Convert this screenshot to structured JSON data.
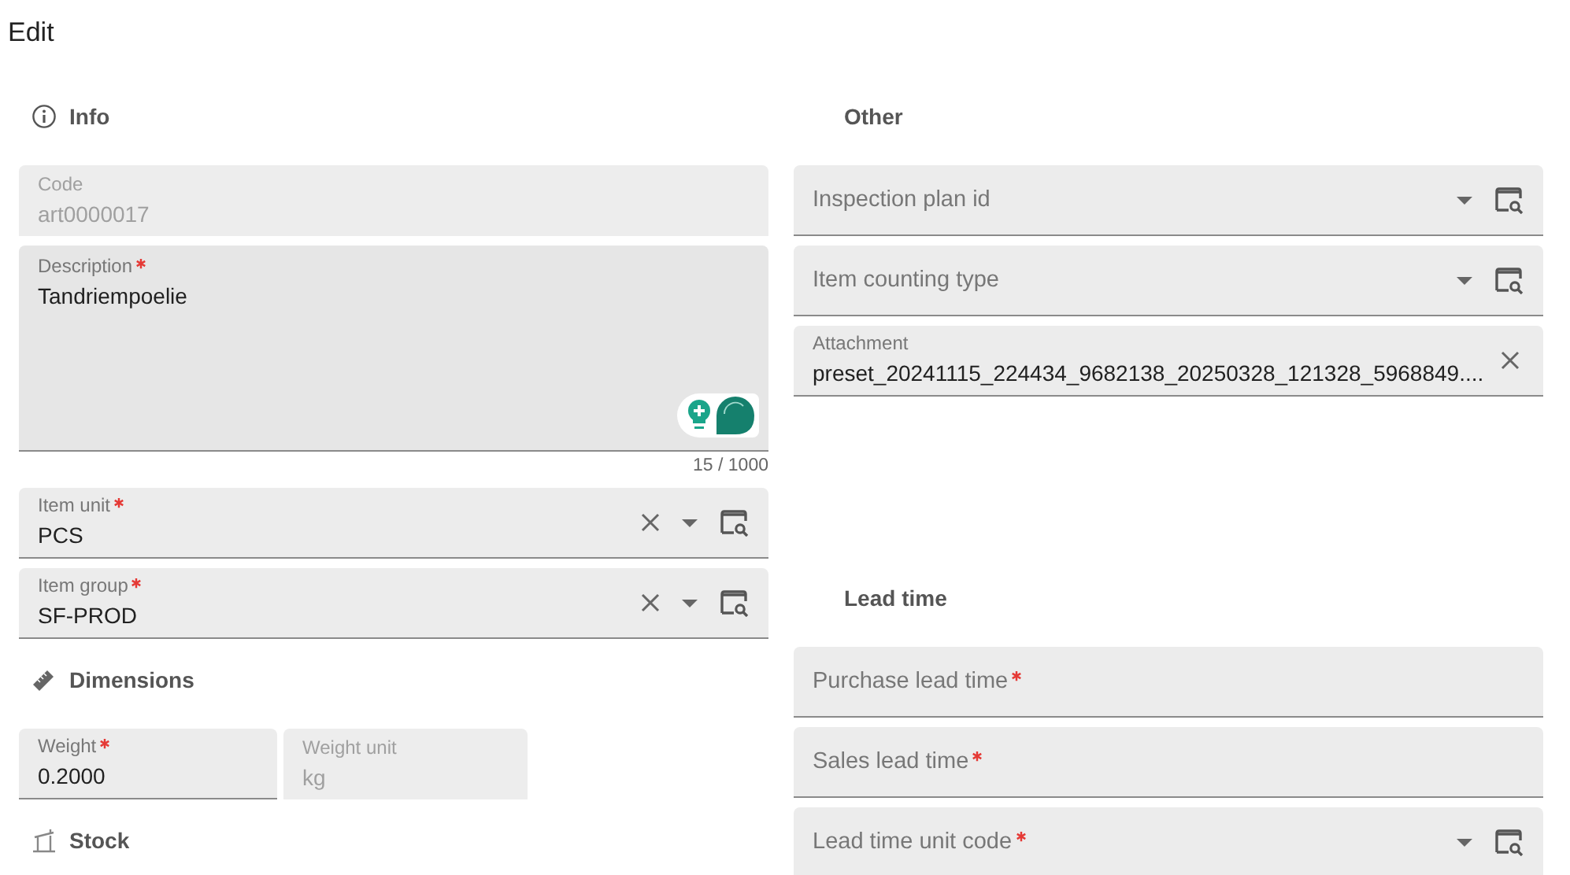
{
  "title": "Edit",
  "columns": [
    {
      "sections": [
        {
          "kind": "info",
          "title": "Info",
          "fields": [
            {
              "kind": "text",
              "label": "Code",
              "value": "art0000017",
              "required": false,
              "disabled": true
            },
            {
              "kind": "textarea",
              "label": "Description",
              "value": "Tandriempoelie",
              "required": true,
              "disabled": false,
              "counter": "15 / 1000"
            },
            {
              "kind": "select",
              "label": "Item unit",
              "value": "PCS",
              "required": true,
              "disabled": false,
              "clearable": true
            },
            {
              "kind": "select",
              "label": "Item group",
              "value": "SF-PROD",
              "required": true,
              "disabled": false,
              "clearable": true
            }
          ]
        },
        {
          "kind": "dimensions",
          "title": "Dimensions",
          "fields": [
            {
              "kind": "row",
              "fields": [
                {
                  "kind": "text",
                  "label": "Weight",
                  "value": "0.2000",
                  "required": true,
                  "disabled": false
                },
                {
                  "kind": "text",
                  "label": "Weight unit",
                  "value": "kg",
                  "required": false,
                  "disabled": true
                }
              ]
            }
          ]
        },
        {
          "kind": "stock",
          "title": "Stock"
        }
      ]
    },
    {
      "sections": [
        {
          "kind": "plain",
          "title": "Other",
          "fields": [
            {
              "kind": "select",
              "label": "Inspection plan id",
              "required": false,
              "disabled": false,
              "clearable": false
            },
            {
              "kind": "select",
              "label": "Item counting type",
              "required": false,
              "disabled": false,
              "clearable": false
            },
            {
              "kind": "file",
              "label": "Attachment",
              "value": "preset_20241115_224434_9682138_20250328_121328_5968849....",
              "required": false,
              "disabled": false,
              "clearable": true
            }
          ]
        },
        {
          "kind": "plain",
          "title": "Lead time",
          "fields": [
            {
              "kind": "text",
              "label": "Purchase lead time",
              "required": true,
              "disabled": false
            },
            {
              "kind": "text",
              "label": "Sales lead time",
              "required": true,
              "disabled": false
            },
            {
              "kind": "select",
              "label": "Lead time unit code",
              "required": true,
              "disabled": false,
              "clearable": false
            }
          ]
        }
      ]
    }
  ]
}
